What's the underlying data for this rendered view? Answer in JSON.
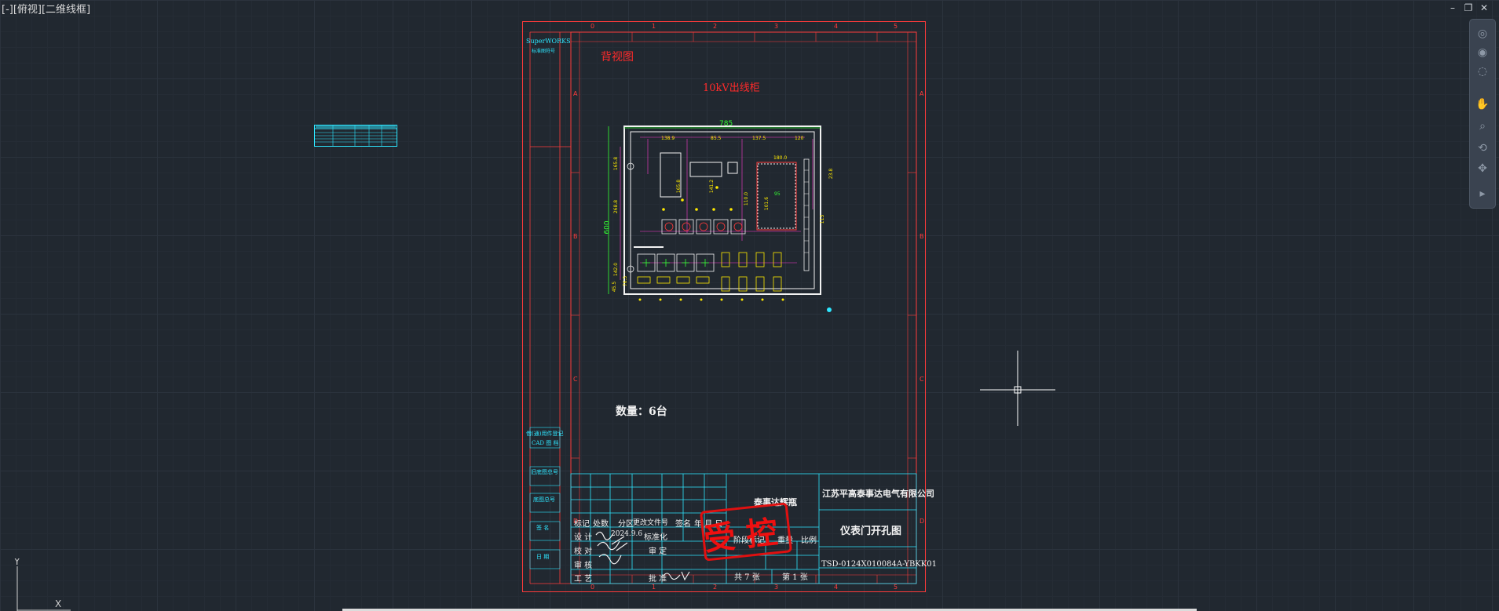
{
  "viewport": {
    "label": "[-][俯视][二维线框]"
  },
  "window_controls": {
    "minimize": "–",
    "restore": "❐",
    "close": "✕"
  },
  "nav_bar": {
    "icons": [
      "steering-wheel-icon",
      "orbit-icon",
      "pan-icon",
      "zoom-icon",
      "showmotion-icon"
    ]
  },
  "colors": {
    "background": "#212830",
    "frame": "#ff3b3b",
    "title_block": "#2ee6ff",
    "dimensions": "#ffea00",
    "green_dims": "#33ff33"
  },
  "drawing": {
    "view_title": "背视图",
    "cabinet_name": "10kV出线柜",
    "quantity_label": "数量：6台",
    "brand": {
      "line1": "SuperWORKS",
      "line2": "标准图符号"
    },
    "dims": {
      "width": "785",
      "height": "600",
      "top_dims": [
        "138.9",
        "85.5",
        "137.5",
        "180.0",
        "120"
      ],
      "left_dims": [
        "165.8",
        "268.8",
        "142.0",
        "45.5",
        "76.5"
      ],
      "right_dims": [
        "23.8",
        "113"
      ],
      "inner_dims": [
        "165.8",
        "141.2",
        "110.0",
        "101.6",
        "95"
      ]
    },
    "ruler_top": [
      "0",
      "1",
      "2",
      "3",
      "4",
      "5"
    ],
    "ruler_bottom": [
      "0",
      "1",
      "2",
      "3",
      "4",
      "5"
    ],
    "ruler_side": [
      "A",
      "B",
      "C",
      "D"
    ],
    "side_labels": [
      "借(通)用件登记",
      "CAD 图 档",
      "旧底图总号",
      "底图总号",
      "签 名",
      "日 期"
    ],
    "title_block": {
      "rev_headers": [
        "标记",
        "处数",
        "分区",
        "更改文件号",
        "签名",
        "年 月 日"
      ],
      "rows": [
        "设 计",
        "校 对",
        "审 核",
        "工 艺"
      ],
      "design_date": "2024.9.6",
      "std_label": "标准化",
      "approve_label": "审 定",
      "approve_by": "批 准",
      "stage_label": "阶段标记",
      "weight_label": "重量",
      "scale_label": "比例",
      "series": "泰事达辉瓶",
      "company": "江苏平高泰事达电气有限公司",
      "drawing_title": "仪表门开孔图",
      "drawing_no": "TSD-0124X010084A-YBKK01",
      "sheets_total": "共 7 张",
      "sheet_no": "第 1 张"
    },
    "stamp": "受控"
  }
}
